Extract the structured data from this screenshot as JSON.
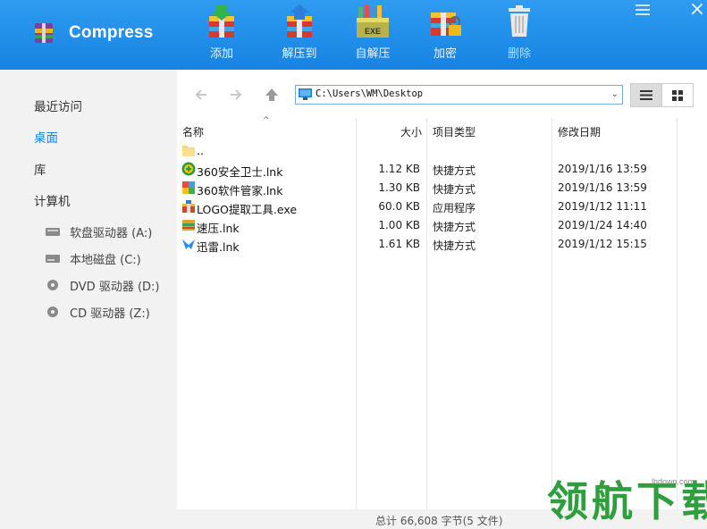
{
  "app": {
    "title": "Compress"
  },
  "toolbar": {
    "add": "添加",
    "extract_to": "解压到",
    "self_extract": "自解压",
    "encrypt": "加密",
    "delete": "删除",
    "exe_badge": "EXE"
  },
  "sidebar": {
    "items": [
      "最近访问",
      "桌面",
      "库",
      "计算机"
    ],
    "active": "桌面",
    "drives": [
      "软盘驱动器 (A:)",
      "本地磁盘 (C:)",
      "DVD 驱动器 (D:)",
      "CD 驱动器 (Z:)"
    ]
  },
  "address": {
    "path": "C:\\Users\\WM\\Desktop"
  },
  "columns": {
    "name": "名称",
    "size": "大小",
    "type": "项目类型",
    "date": "修改日期"
  },
  "files": [
    {
      "name": "..",
      "size": "",
      "type": "",
      "date": "",
      "icon": "folder-icon"
    },
    {
      "name": "360安全卫士.lnk",
      "size": "1.12 KB",
      "type": "快捷方式",
      "date": "2019/1/16 13:59",
      "icon": "360-safe-icon"
    },
    {
      "name": "360软件管家.lnk",
      "size": "1.30 KB",
      "type": "快捷方式",
      "date": "2019/1/16 13:59",
      "icon": "360-software-icon"
    },
    {
      "name": "LOGO提取工具.exe",
      "size": "60.0 KB",
      "type": "应用程序",
      "date": "2019/1/12 11:11",
      "icon": "logo-tool-icon"
    },
    {
      "name": "速压.lnk",
      "size": "1.00 KB",
      "type": "快捷方式",
      "date": "2019/1/24 14:40",
      "icon": "suya-icon"
    },
    {
      "name": "迅雷.lnk",
      "size": "1.61 KB",
      "type": "快捷方式",
      "date": "2019/1/12 15:15",
      "icon": "xunlei-icon"
    }
  ],
  "status": {
    "text": "总计   66,608 字节(5 文件)"
  },
  "watermark": {
    "text": "领航下载",
    "url": "lhdown.com"
  },
  "colors": {
    "header": "#1c8ae6",
    "accent": "#1a86e0",
    "watermark": "#2e9f3c"
  }
}
